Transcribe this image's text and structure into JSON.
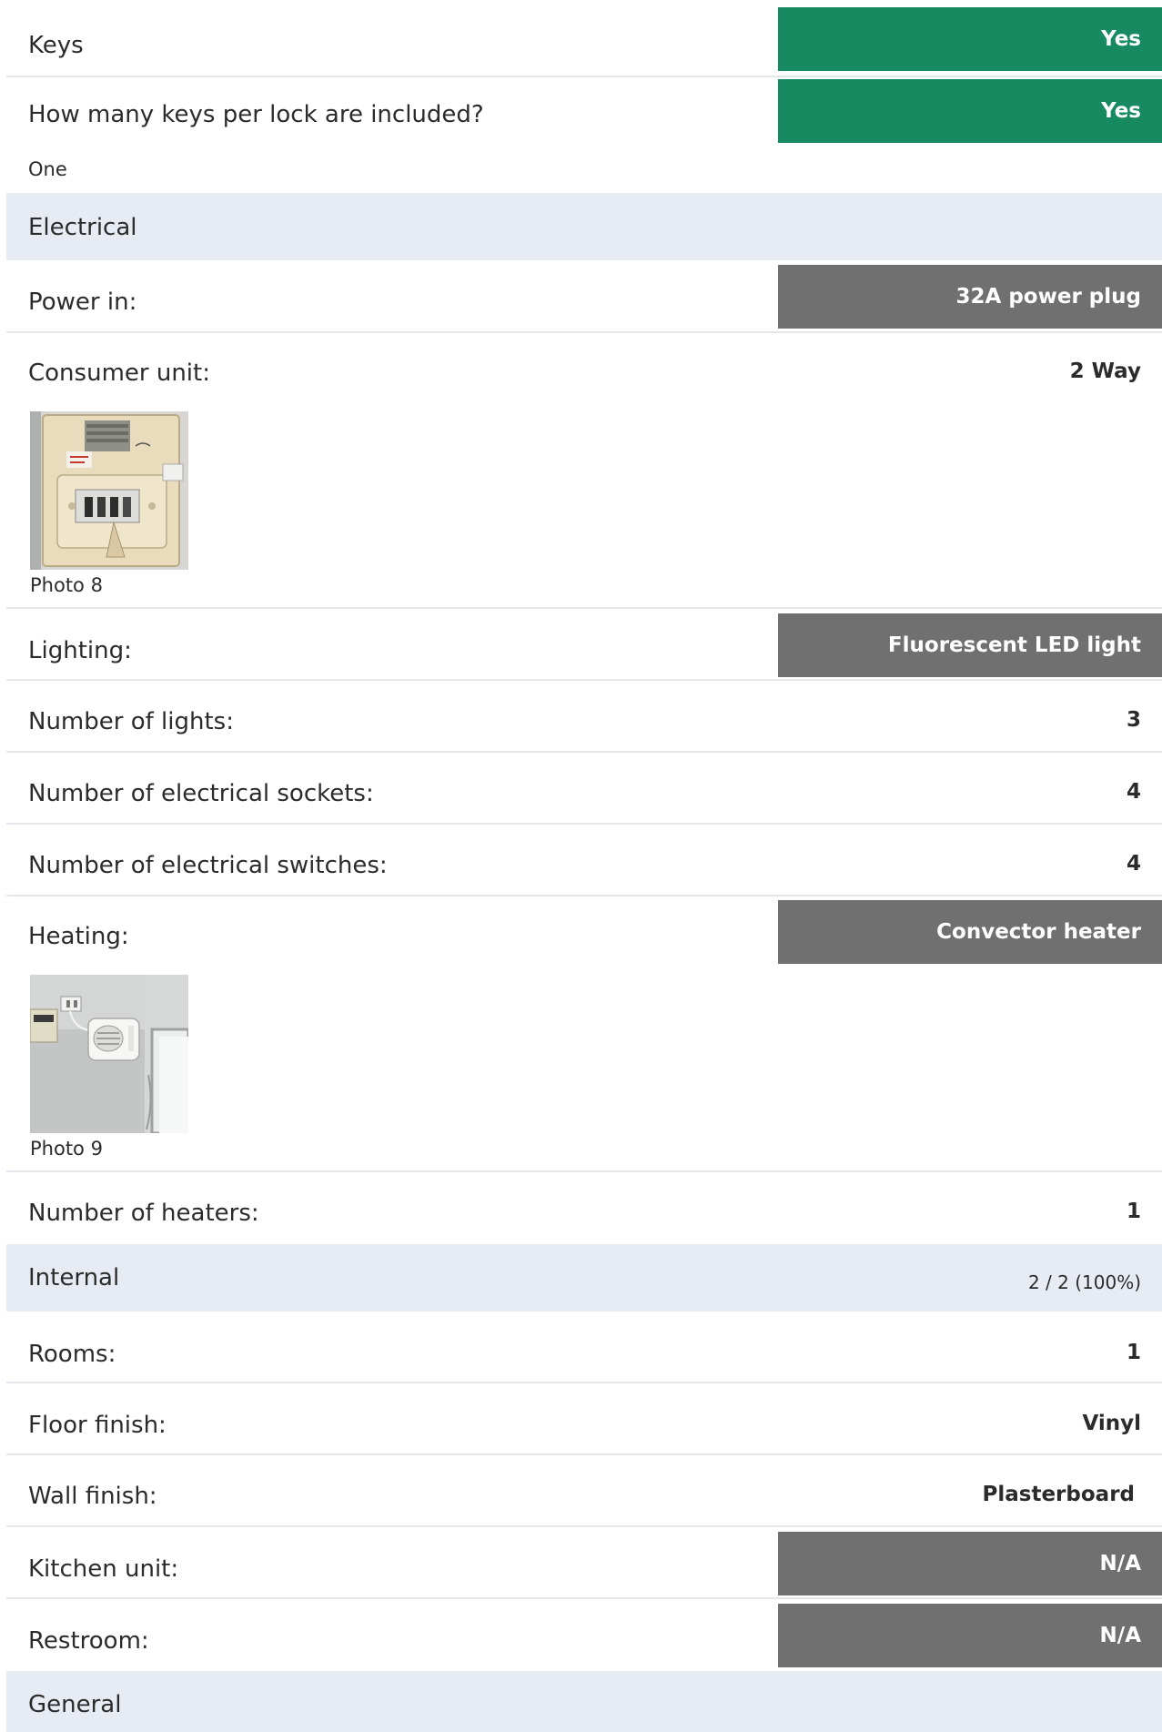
{
  "rows": {
    "keys": {
      "label": "Keys",
      "value": "Yes"
    },
    "keys_per_lock": {
      "label": "How many keys per lock are included?",
      "value": "Yes",
      "note": "One"
    },
    "electrical": {
      "label": "Electrical"
    },
    "power_in": {
      "label": "Power in:",
      "value": "32A power plug"
    },
    "consumer_unit": {
      "label": "Consumer unit:",
      "value": "2 Way",
      "photo_caption": "Photo 8"
    },
    "lighting": {
      "label": "Lighting:",
      "value": "Fluorescent LED light"
    },
    "num_lights": {
      "label": "Number of lights:",
      "value": "3"
    },
    "num_sockets": {
      "label": "Number of electrical sockets:",
      "value": "4"
    },
    "num_switches": {
      "label": "Number of electrical switches:",
      "value": "4"
    },
    "heating": {
      "label": "Heating:",
      "value": "Convector heater",
      "photo_caption": "Photo 9"
    },
    "num_heaters": {
      "label": "Number of heaters:",
      "value": "1"
    },
    "internal": {
      "label": "Internal",
      "progress": "2 / 2 (100%)"
    },
    "rooms": {
      "label": "Rooms:",
      "value": "1"
    },
    "floor_finish": {
      "label": "Floor finish:",
      "value": "Vinyl"
    },
    "wall_finish": {
      "label": "Wall finish:",
      "value": "Plasterboard"
    },
    "kitchen_unit": {
      "label": "Kitchen unit:",
      "value": "N/A"
    },
    "restroom": {
      "label": "Restroom:",
      "value": "N/A"
    },
    "general": {
      "label": "General"
    }
  },
  "colors": {
    "positive_badge": "#178a61",
    "neutral_badge": "#707070",
    "section_bg": "#e7ecf4"
  }
}
